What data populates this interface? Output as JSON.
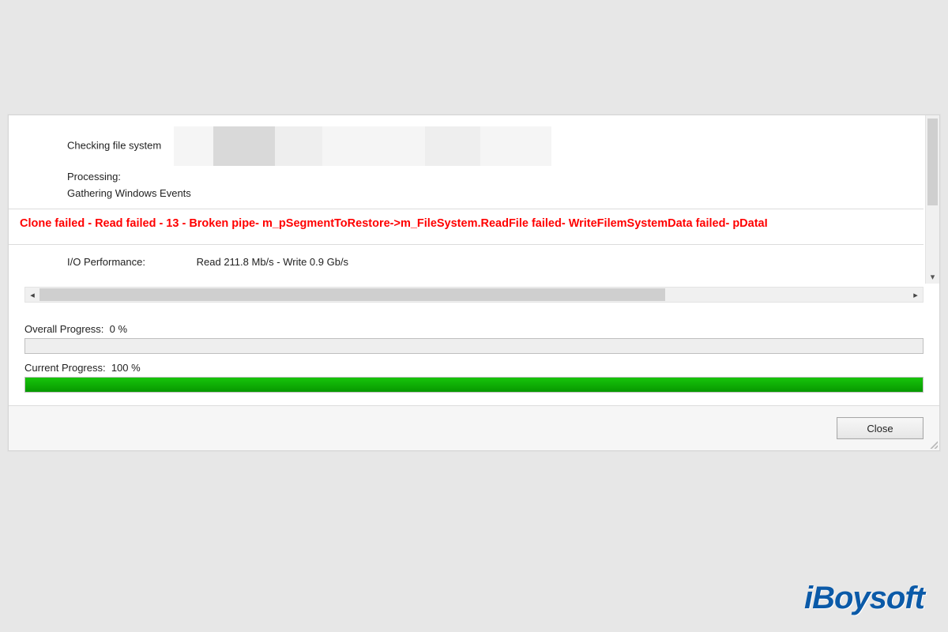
{
  "log": {
    "checking": "Checking file system",
    "processing_label": "Processing:",
    "gathering": "Gathering Windows Events",
    "error": "Clone failed - Read failed - 13 - Broken pipe- m_pSegmentToRestore->m_FileSystem.ReadFile failed- WriteFilemSystemData failed- pDataI",
    "io_label": "I/O Performance:",
    "io_value": "Read 211.8 Mb/s - Write 0.9 Gb/s"
  },
  "progress": {
    "overall_label": "Overall Progress:",
    "overall_value": "0 %",
    "overall_fill_pct": 0,
    "current_label": "Current Progress:",
    "current_value": "100 %",
    "current_fill_pct": 100
  },
  "footer": {
    "close_label": "Close"
  },
  "colors": {
    "error_text": "#ff0000",
    "progress_green": "#0fb400"
  },
  "watermark": "iBoysoft"
}
